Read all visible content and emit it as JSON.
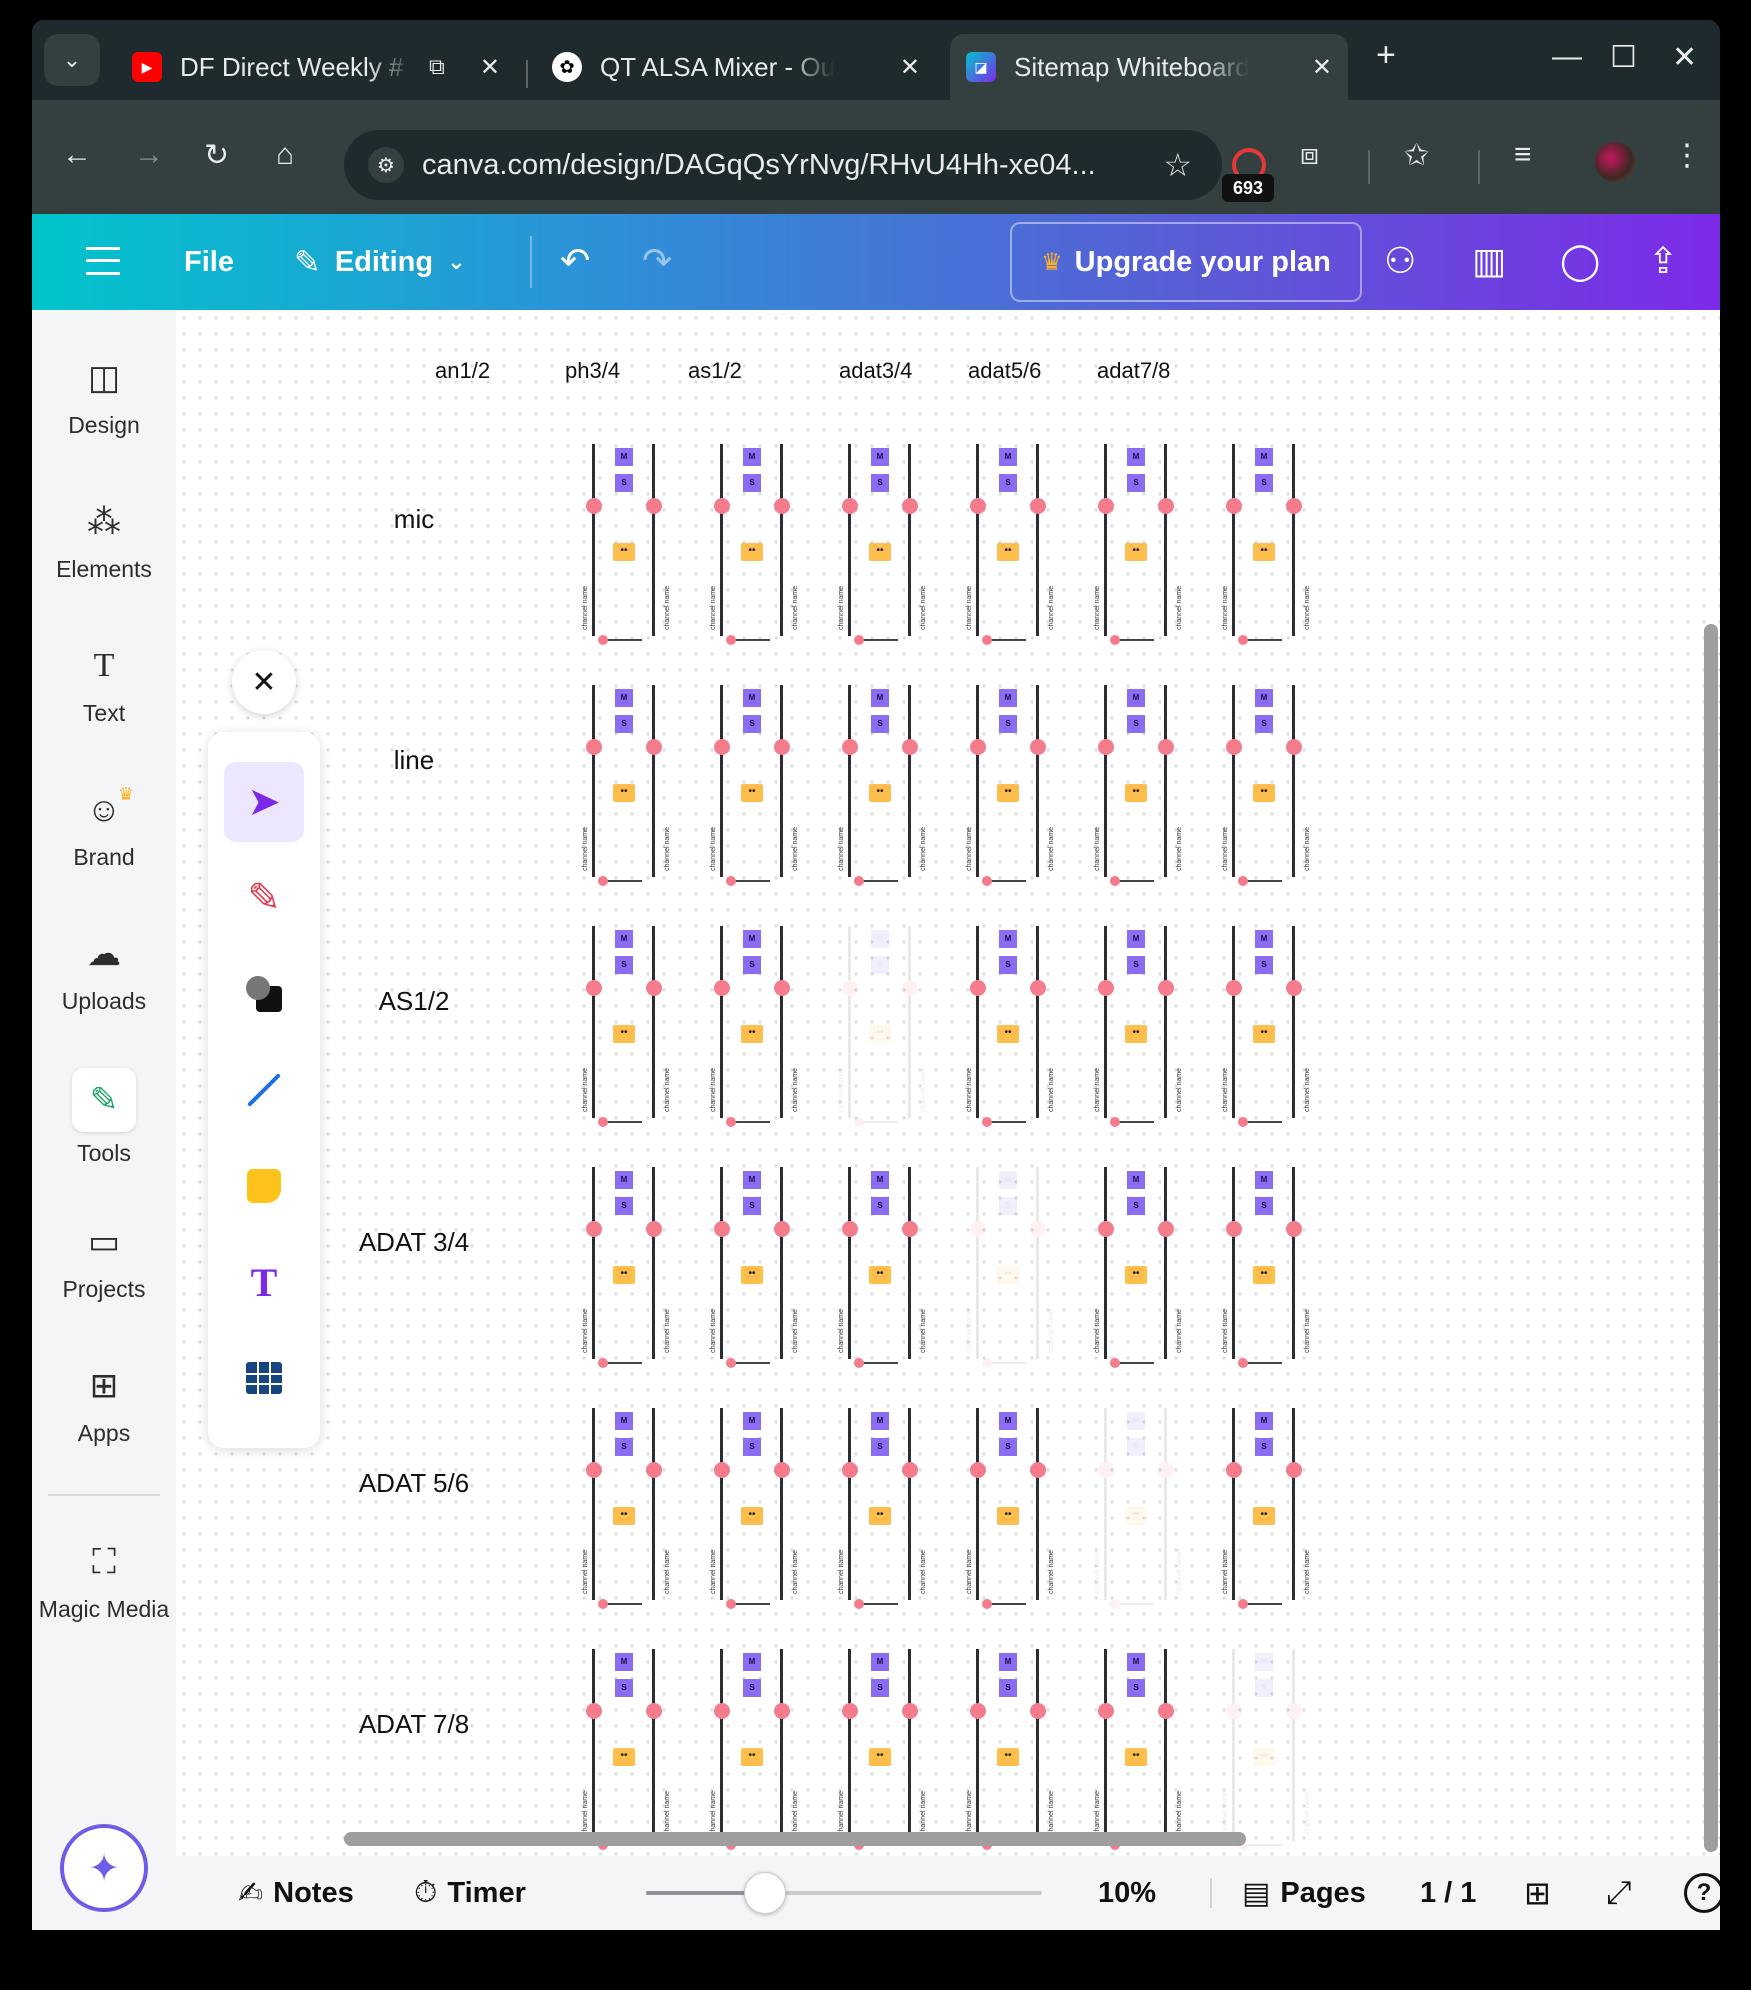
{
  "browser": {
    "tabs": [
      {
        "title": "DF Direct Weekly #",
        "favicon": "youtube-icon",
        "color": "#ff0000"
      },
      {
        "title": "QT ALSA Mixer - Output",
        "favicon": "openai-icon",
        "color": "#ffffff"
      },
      {
        "title": "Sitemap Whiteboard in Canva",
        "favicon": "canva-icon",
        "color": "#7d2ae8"
      }
    ],
    "url": "canva.com/design/DAGqQsYrNvg/RHvU4Hh-xe04...",
    "extension_badge": "693"
  },
  "canva": {
    "menu": {
      "file": "File",
      "editing": "Editing",
      "upgrade": "Upgrade your plan"
    },
    "sidebar": [
      {
        "label": "Design",
        "icon": "design-icon"
      },
      {
        "label": "Elements",
        "icon": "elements-icon"
      },
      {
        "label": "Text",
        "icon": "text-icon"
      },
      {
        "label": "Brand",
        "icon": "brand-icon"
      },
      {
        "label": "Uploads",
        "icon": "uploads-icon"
      },
      {
        "label": "Tools",
        "icon": "tools-icon"
      },
      {
        "label": "Projects",
        "icon": "projects-icon"
      },
      {
        "label": "Apps",
        "icon": "apps-icon"
      },
      {
        "label": "Magic Media",
        "icon": "magic-media-icon"
      }
    ],
    "tools": [
      "select-tool",
      "pen-tool",
      "shapes-tool",
      "line-tool",
      "sticky-note-tool",
      "text-tool",
      "table-tool"
    ],
    "bottom": {
      "notes": "Notes",
      "timer": "Timer",
      "zoom": "10%",
      "zoom_fraction": 0.3,
      "pages": "Pages",
      "page_count": "1 / 1"
    }
  },
  "matrix": {
    "columns": [
      "an1/2",
      "ph3/4",
      "as1/2",
      "adat3/4",
      "adat5/6",
      "adat7/8"
    ],
    "rows": [
      "mic",
      "line",
      "AS1/2",
      "ADAT 3/4",
      "ADAT 5/6",
      "ADAT 7/8"
    ],
    "mute_label": "M",
    "solo_label": "S",
    "link_label": "••",
    "channel_label": "channel name",
    "disabled_cells": [
      [
        2,
        2
      ],
      [
        3,
        3
      ],
      [
        4,
        4
      ],
      [
        5,
        5
      ]
    ]
  },
  "colors": {
    "accent": "#7d2ae8",
    "mute_solo": "#8b6cf2",
    "link": "#ffbe4c",
    "fader_dot": "#f47c8c"
  }
}
